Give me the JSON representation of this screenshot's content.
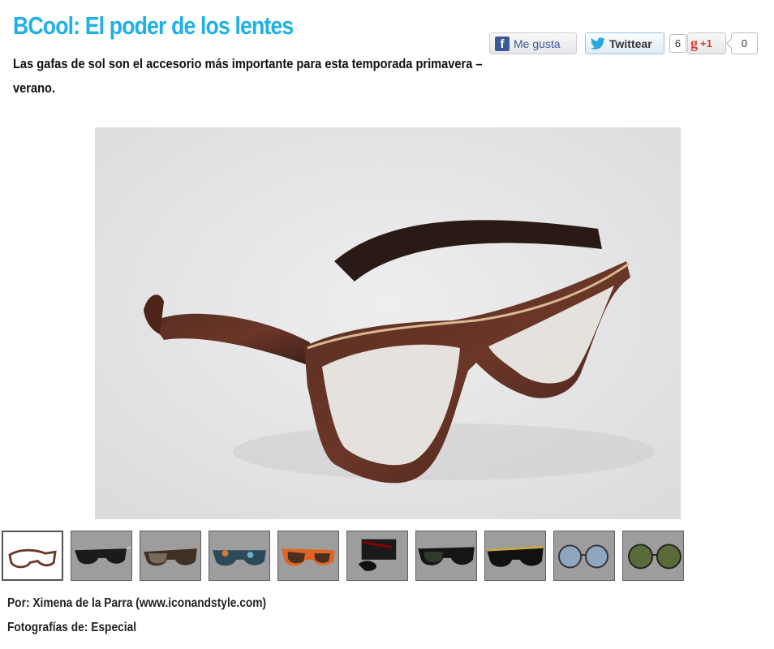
{
  "article": {
    "title": "BCool: El poder de los lentes",
    "subtitle": "Las gafas de sol son el accesorio más importante para esta temporada primavera – verano.",
    "author": "Por: Ximena de la Parra (www.iconandstyle.com)",
    "photos": "Fotografías de: Especial"
  },
  "share": {
    "facebook_label": "Me gusta",
    "twitter_label": "Twittear",
    "twitter_count": "6",
    "gplus_label": "+1",
    "gplus_count": "0"
  },
  "gallery": {
    "main_image": "wooden-eyeglasses-photo",
    "thumbnails": [
      {
        "id": "wood-eyeglasses",
        "active": true
      },
      {
        "id": "black-sunglasses"
      },
      {
        "id": "brown-sunglasses"
      },
      {
        "id": "pattern-sunglasses"
      },
      {
        "id": "orange-sunglasses"
      },
      {
        "id": "rayban-case"
      },
      {
        "id": "black-green-sunglasses"
      },
      {
        "id": "gold-sunglasses"
      },
      {
        "id": "round-blue-sunglasses"
      },
      {
        "id": "round-green-sunglasses"
      }
    ]
  },
  "colors": {
    "title": "#1fb0e6",
    "facebook": "#3b5998",
    "gplus": "#d73d32"
  }
}
